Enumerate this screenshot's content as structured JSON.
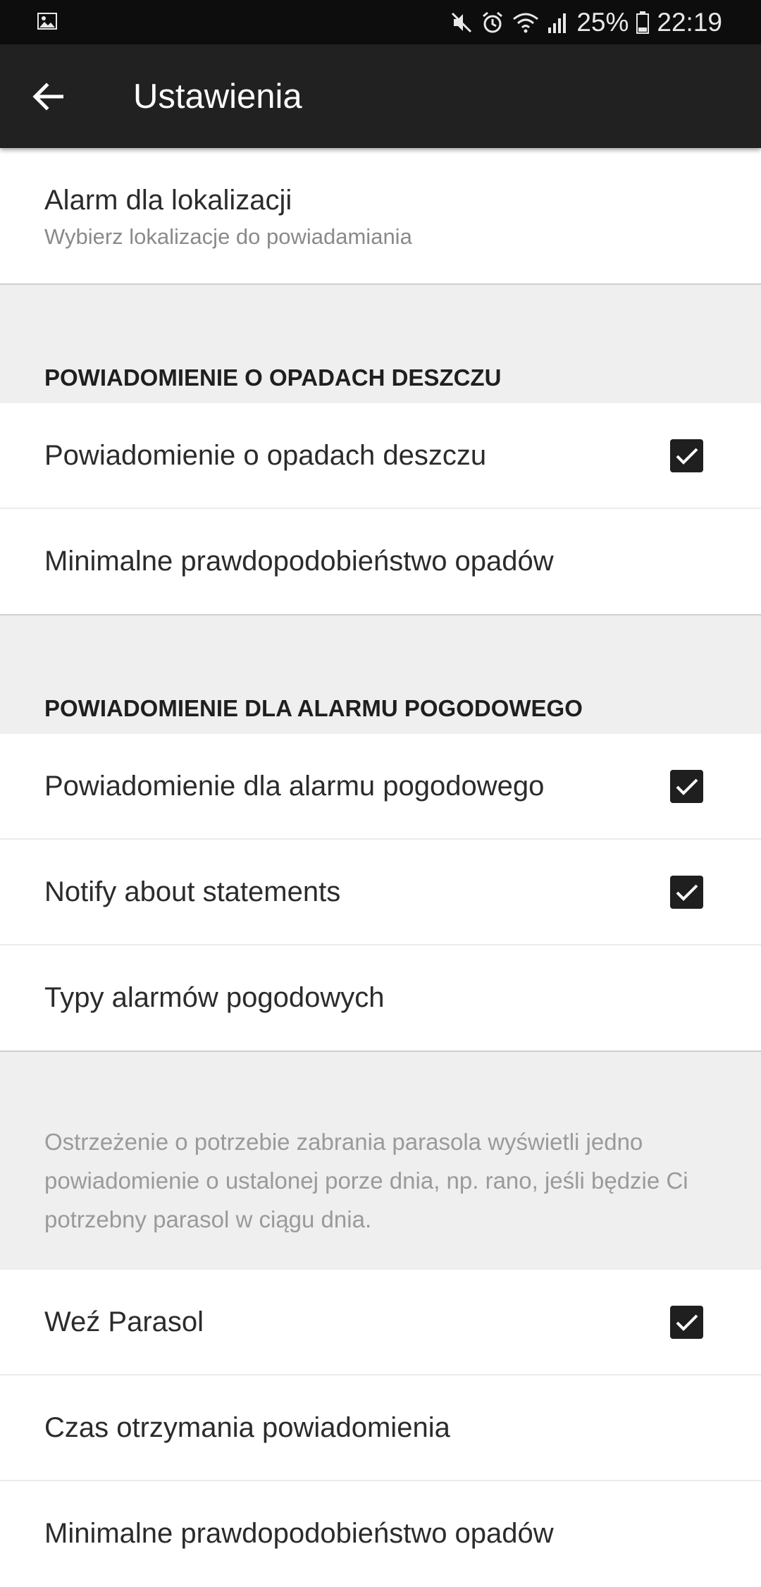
{
  "status_bar": {
    "icons": [
      "gallery-icon",
      "mute-icon",
      "alarm-icon",
      "wifi-icon",
      "signal-icon",
      "battery-icon"
    ],
    "battery": "25%",
    "time": "22:19"
  },
  "app_bar": {
    "back_icon": "arrow-back-icon",
    "title": "Ustawienia"
  },
  "location_alarm": {
    "title": "Alarm dla lokalizacji",
    "summary": "Wybierz lokalizacje do powiadamiania"
  },
  "rain_section": {
    "header": "POWIADOMIENIE O OPADACH DESZCZU",
    "items": [
      {
        "title": "Powiadomienie o opadach deszczu",
        "checked": true
      },
      {
        "title": "Minimalne prawdopodobieństwo opadów"
      }
    ]
  },
  "weather_alarm_section": {
    "header": "POWIADOMIENIE DLA ALARMU POGODOWEGO",
    "items": [
      {
        "title": "Powiadomienie dla alarmu pogodowego",
        "checked": true
      },
      {
        "title": "Notify about statements",
        "checked": true
      },
      {
        "title": "Typy alarmów pogodowych"
      }
    ]
  },
  "umbrella_section": {
    "description": "Ostrzeżenie o potrzebie zabrania parasola wyświetli jedno powiadomienie o ustalonej porze dnia, np. rano, jeśli będzie Ci potrzebny parasol w ciągu dnia.",
    "items": [
      {
        "title": "Weź Parasol",
        "checked": true
      },
      {
        "title": "Czas otrzymania powiadomienia"
      },
      {
        "title": "Minimalne prawdopodobieństwo opadów"
      }
    ]
  },
  "colors": {
    "app_bar": "#212121",
    "status_bar": "#0d0d0d",
    "section_bg": "#efefef",
    "checkbox": "#1f1f1f"
  }
}
